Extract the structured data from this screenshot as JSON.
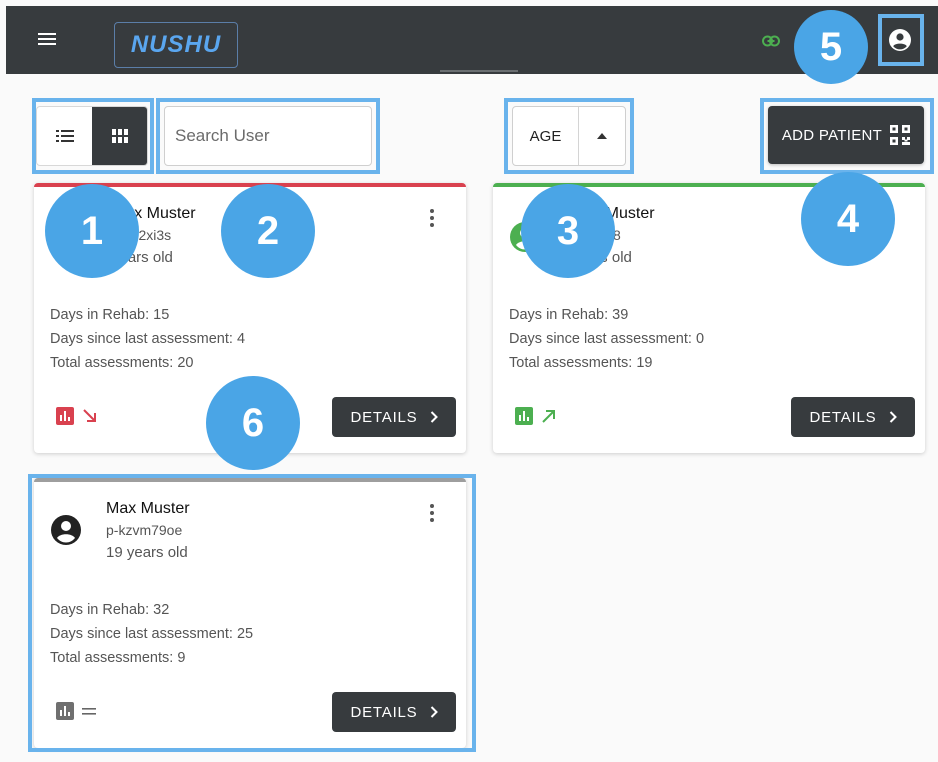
{
  "app": {
    "logo_text": "NUSHU"
  },
  "toolbar": {
    "search_placeholder": "Search User",
    "sort_label": "AGE",
    "add_patient_label": "ADD PATIENT"
  },
  "patients": [
    {
      "name": "Max Muster",
      "id": "p-…2xi3s",
      "age_text": "years old",
      "days_in_rehab": "Days in Rehab: 15",
      "days_since_assessment": "Days since last assessment: 4",
      "total_assessments": "Total assessments: 20",
      "status_color": "#d9414f",
      "trend": "down",
      "details_label": "DETAILS"
    },
    {
      "name": "Max Muster",
      "id": "p-…328",
      "age_text": "years old",
      "days_in_rehab": "Days in Rehab: 39",
      "days_since_assessment": "Days since last assessment: 0",
      "total_assessments": "Total assessments: 19",
      "status_color": "#4caf50",
      "trend": "up",
      "details_label": "DETAILS"
    },
    {
      "name": "Max Muster",
      "id": "p-kzvm79oe",
      "age_text": "19 years old",
      "days_in_rehab": "Days in Rehab: 32",
      "days_since_assessment": "Days since last assessment: 25",
      "total_assessments": "Total assessments: 9",
      "status_color": "#9e9e9e",
      "trend": "flat",
      "details_label": "DETAILS"
    }
  ],
  "annotations": {
    "color": "#69b3ec",
    "badges": [
      "1",
      "2",
      "3",
      "4",
      "5",
      "6"
    ]
  },
  "icons": {
    "menu": "menu-icon",
    "link": "link-icon",
    "account": "account-circle-icon",
    "list_view": "list-view-icon",
    "grid_view": "grid-view-icon",
    "sort_asc": "arrow-up-icon",
    "qr": "qr-code-icon",
    "chevron": "chevron-right-icon"
  }
}
